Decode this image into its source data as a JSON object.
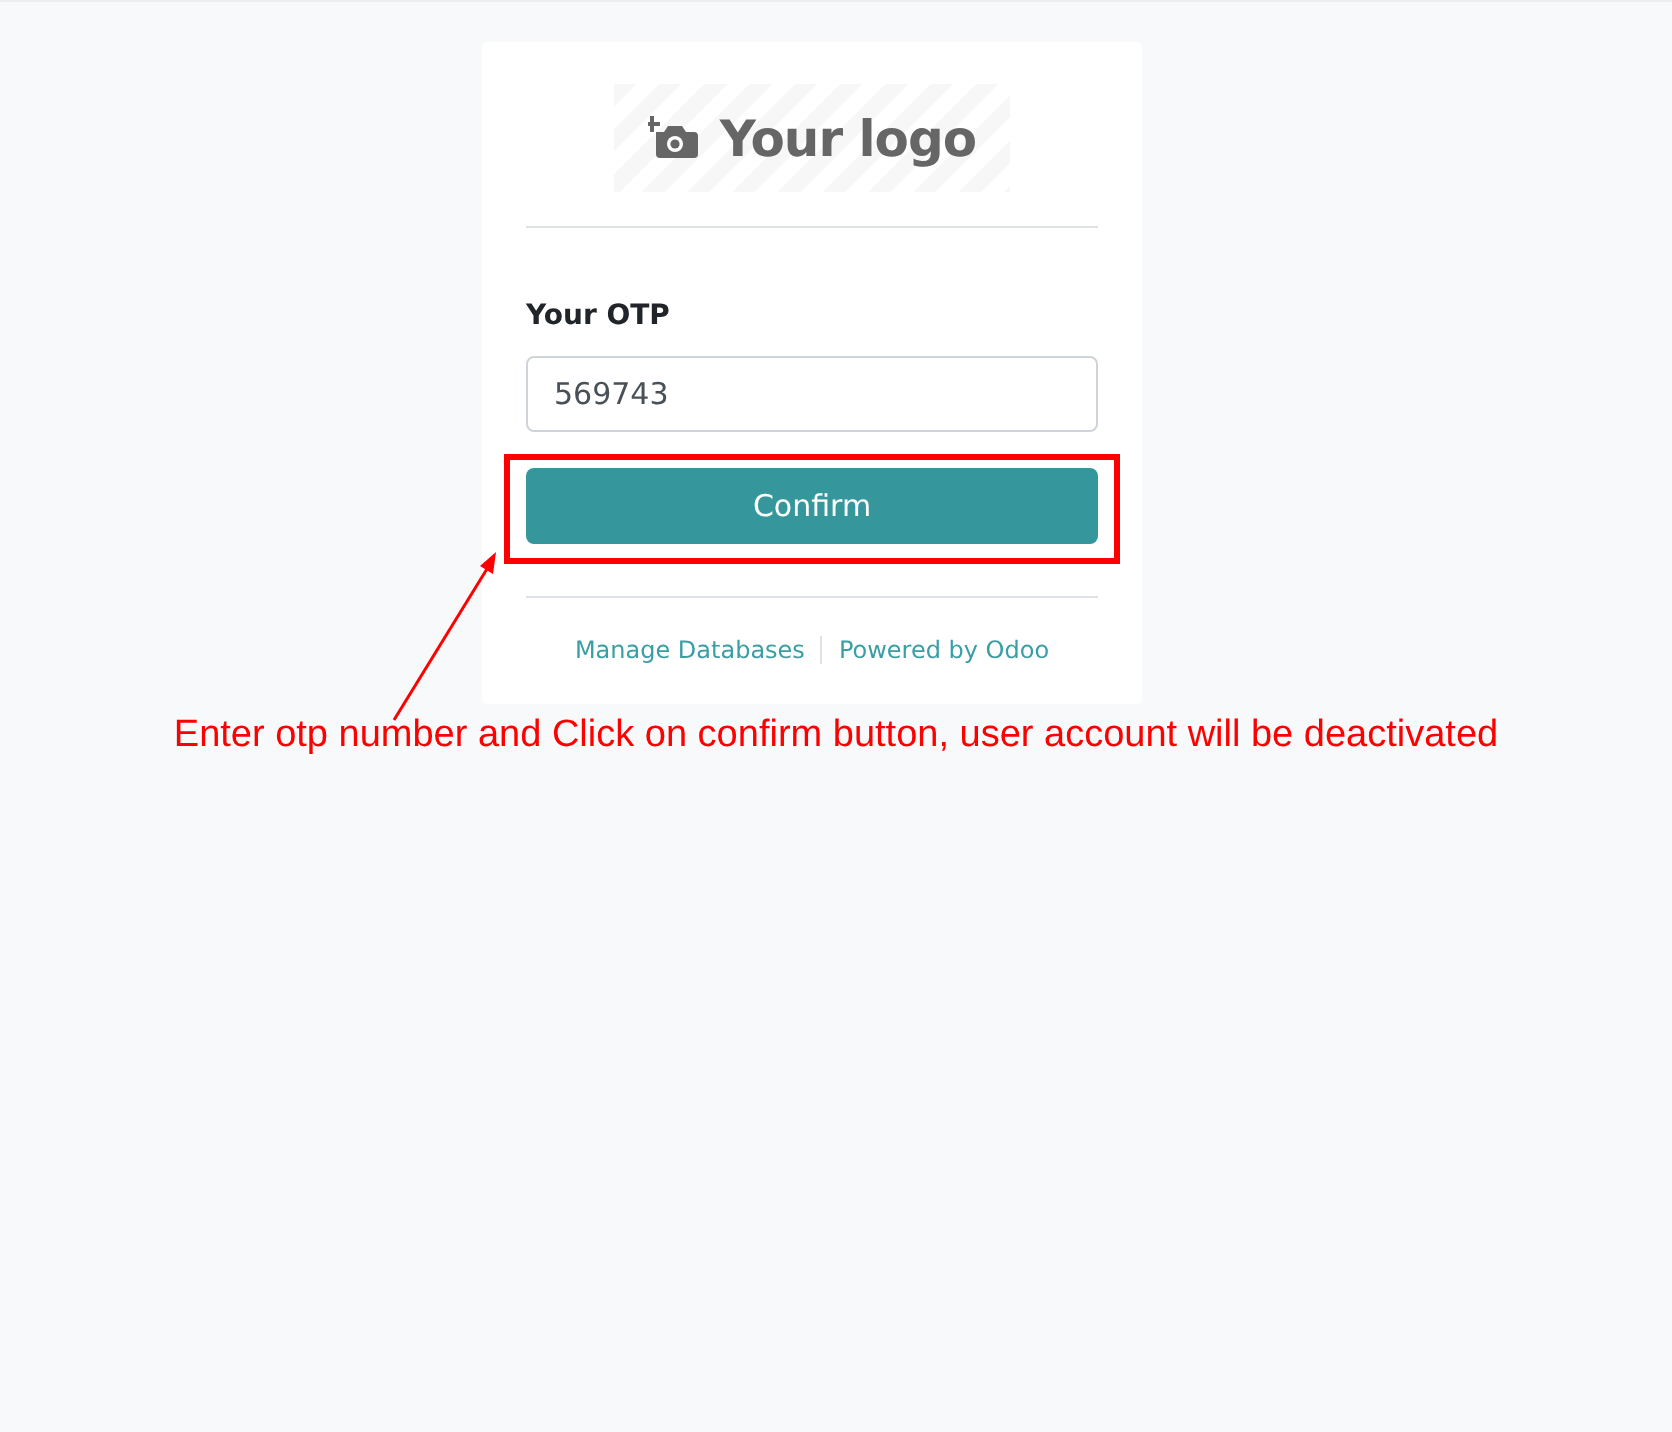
{
  "logo": {
    "text": "Your logo"
  },
  "form": {
    "label": "Your OTP",
    "value": "569743",
    "button": "Confirm"
  },
  "footer_links": [
    "Manage Databases",
    "Powered by Odoo"
  ],
  "annotation": {
    "text": "Enter otp number and Click on confirm button, user account will be deactivated"
  }
}
